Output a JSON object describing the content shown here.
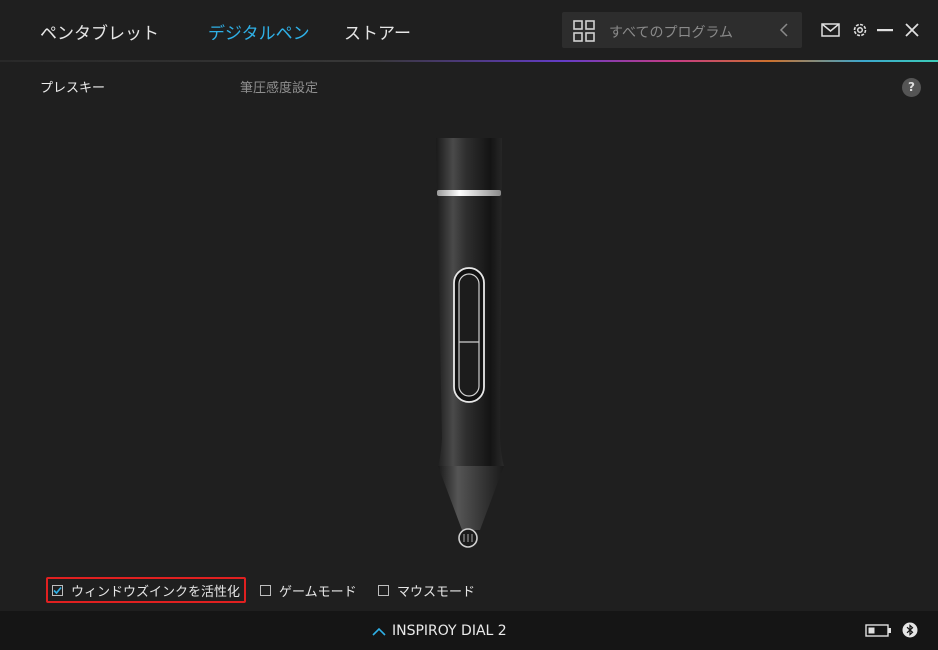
{
  "nav": {
    "tabs": [
      {
        "label": "ペンタブレット",
        "active": false
      },
      {
        "label": "デジタルペン",
        "active": true
      },
      {
        "label": "ストアー",
        "active": false
      }
    ]
  },
  "search": {
    "placeholder": "すべてのプログラム"
  },
  "subtabs": [
    {
      "label": "プレスキー",
      "active": true
    },
    {
      "label": "筆圧感度設定",
      "active": false
    }
  ],
  "help_label": "?",
  "options": [
    {
      "label": "ウィンドウズインクを活性化",
      "checked": true
    },
    {
      "label": "ゲームモード",
      "checked": false
    },
    {
      "label": "マウスモード",
      "checked": false
    }
  ],
  "footer": {
    "device_name": "INSPIROY DIAL 2"
  },
  "colors": {
    "accent": "#2fb0e6",
    "highlight": "#e02020"
  }
}
